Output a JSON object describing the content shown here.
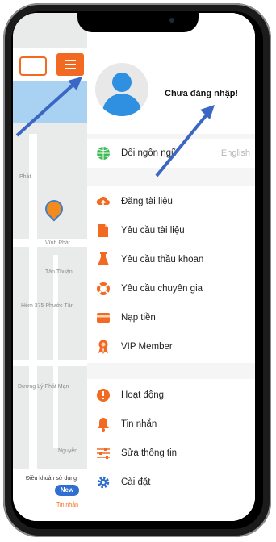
{
  "map": {
    "labels": [
      "Phát",
      "Vĩnh Phát",
      "Tân Thuận",
      "Hẻm 375 Phước Tân",
      "Đường Lý Phát Mạn",
      "Nguyễn"
    ],
    "bottom": {
      "terms": "Điều khoản sử dụng",
      "new_badge": "New",
      "tin_nhan": "Tin nhắn"
    }
  },
  "drawer": {
    "login_status": "Chưa đăng nhập!",
    "language": {
      "label": "Đổi ngôn ngữ",
      "value": "English"
    },
    "menu1": [
      {
        "name": "upload",
        "label": "Đăng tài liệu",
        "icon": "cloud-upload-icon",
        "color": "#f26a21"
      },
      {
        "name": "request-doc",
        "label": "Yêu cầu tài liệu",
        "icon": "document-icon",
        "color": "#f26a21"
      },
      {
        "name": "request-bid",
        "label": "Yêu cầu thầu khoan",
        "icon": "flask-icon",
        "color": "#f26a21"
      },
      {
        "name": "request-expert",
        "label": "Yêu cầu chuyên gia",
        "icon": "lifebuoy-icon",
        "color": "#f26a21"
      },
      {
        "name": "topup",
        "label": "Nạp tiền",
        "icon": "credit-card-icon",
        "color": "#f26a21"
      },
      {
        "name": "vip",
        "label": "VIP Member",
        "icon": "medal-icon",
        "color": "#f26a21"
      }
    ],
    "menu2": [
      {
        "name": "activity",
        "label": "Hoạt động",
        "icon": "alert-circle-icon",
        "color": "#f26a21"
      },
      {
        "name": "messages",
        "label": "Tin nhắn",
        "icon": "bell-icon",
        "color": "#f26a21"
      },
      {
        "name": "edit-info",
        "label": "Sửa thông tin",
        "icon": "sliders-icon",
        "color": "#f26a21"
      },
      {
        "name": "settings",
        "label": "Cài đặt",
        "icon": "gear-icon",
        "color": "#2f6fcf"
      }
    ]
  }
}
